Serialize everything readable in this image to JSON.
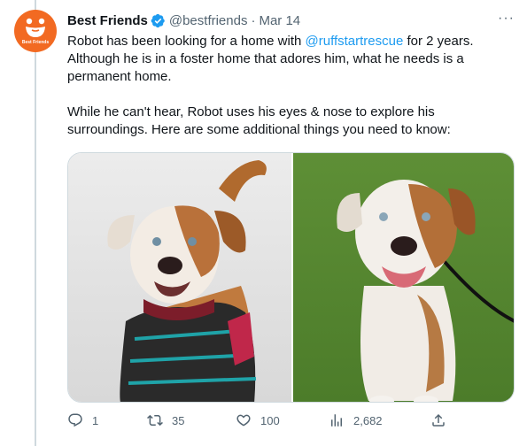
{
  "tweet": {
    "author_name": "Best Friends",
    "handle": "@bestfriends",
    "separator": "·",
    "date": "Mar 14",
    "avatar_text": "Best Friends",
    "more_label": "···",
    "text_before_mention": "Robot has been looking for a home with ",
    "mention": "@ruffstartrescue",
    "text_after_mention": " for 2 years. Although he is in a foster home that adores him, what he needs is a permanent home.",
    "paragraph2": "While he can't hear, Robot uses his eyes & nose to explore his surroundings. Here are some additional things you need to know:"
  },
  "actions": {
    "replies": "1",
    "retweets": "35",
    "likes": "100",
    "views": "2,682"
  },
  "colors": {
    "accent": "#1d9bf0",
    "brand": "#f26a22",
    "muted": "#536471"
  },
  "icons": [
    "badge-check-icon",
    "more-icon",
    "reply-icon",
    "retweet-icon",
    "like-icon",
    "views-icon",
    "share-icon"
  ]
}
